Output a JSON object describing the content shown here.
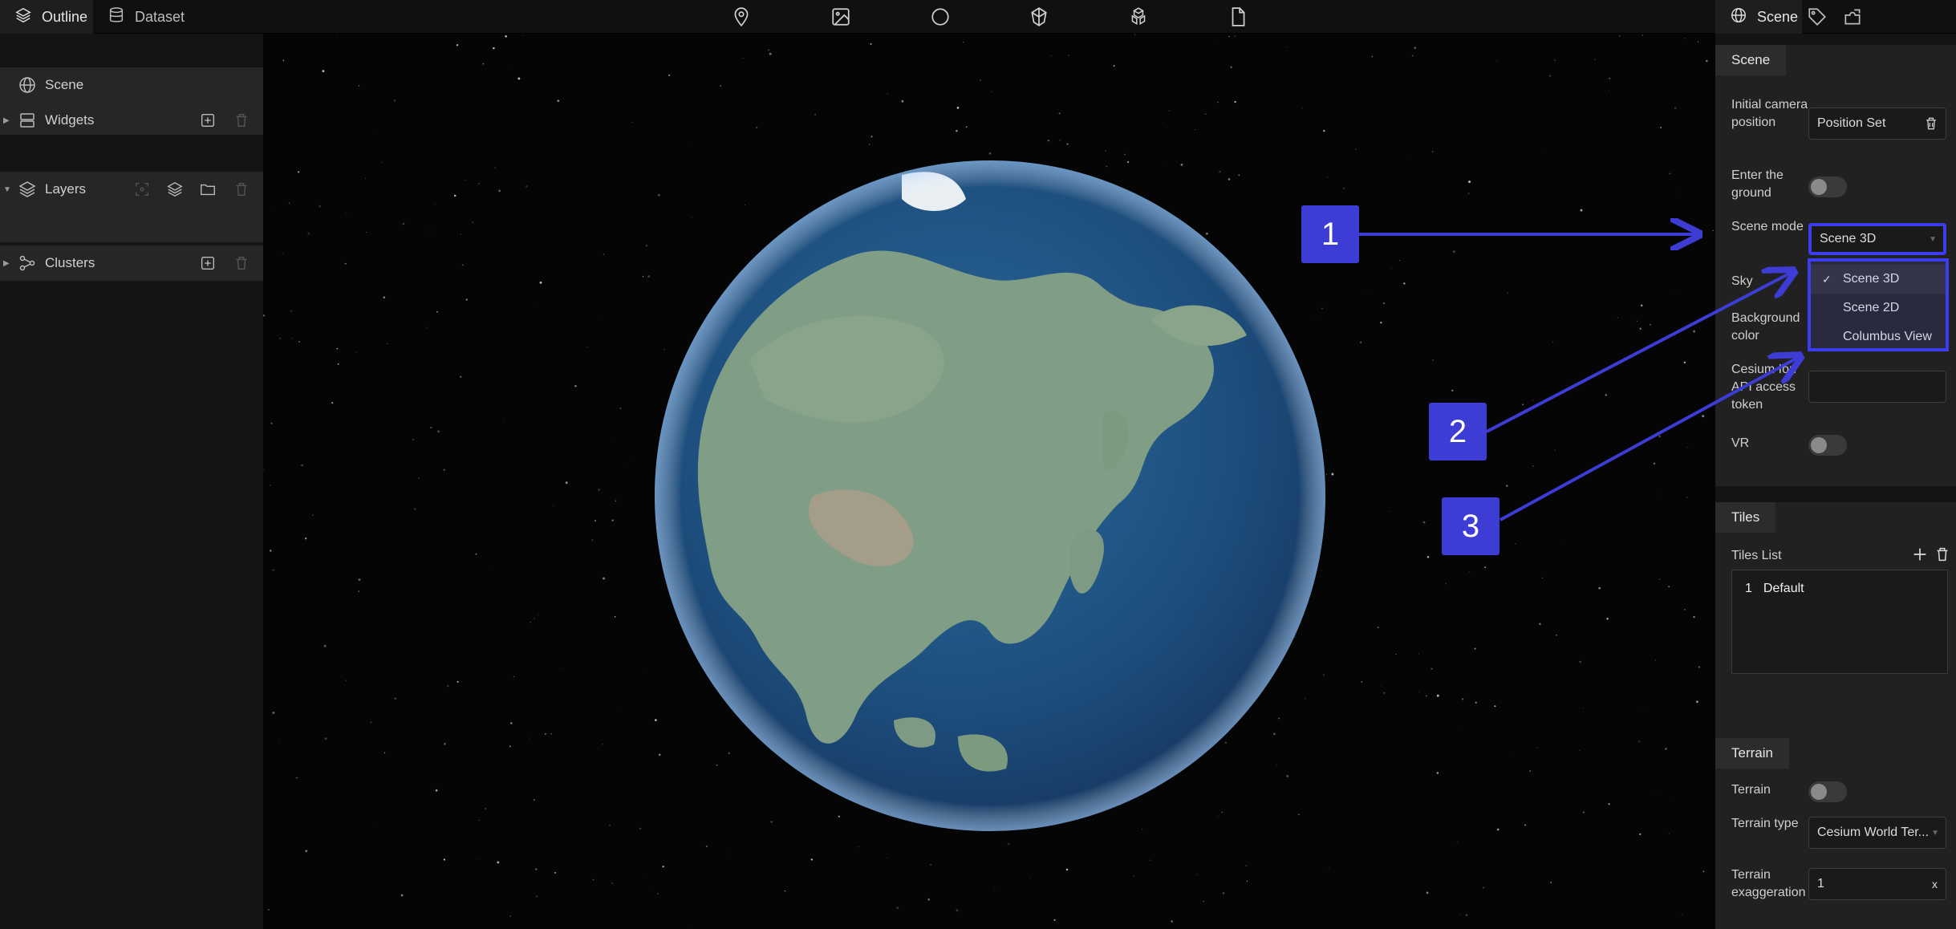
{
  "top_tabs": {
    "outline": "Outline",
    "dataset": "Dataset"
  },
  "toolbar_icons": [
    "map-pin-icon",
    "image-icon",
    "circle-icon",
    "cube-icon",
    "cubes-icon",
    "file-icon"
  ],
  "left_panel": {
    "scene": "Scene",
    "widgets": "Widgets",
    "layers": "Layers",
    "clusters": "Clusters"
  },
  "right_tabs": {
    "scene": "Scene"
  },
  "scene_group": {
    "title": "Scene",
    "initial_camera_label": "Initial camera position",
    "initial_camera_value": "Position Set",
    "enter_ground_label": "Enter the ground",
    "scene_mode_label": "Scene mode",
    "scene_mode_value": "Scene 3D",
    "sky_label": "Sky",
    "background_label": "Background color",
    "token_label": "Cesium Ion API access token",
    "vr_label": "VR"
  },
  "scene_mode_options": [
    "Scene 3D",
    "Scene 2D",
    "Columbus View"
  ],
  "tiles_group": {
    "title": "Tiles",
    "list_label": "Tiles List",
    "item_index": "1",
    "item_name": "Default"
  },
  "terrain_group": {
    "title": "Terrain",
    "terrain_label": "Terrain",
    "type_label": "Terrain type",
    "type_value": "Cesium World Ter...",
    "exag_label": "Terrain exaggeration",
    "exag_value": "1",
    "exag_clear": "x"
  },
  "callouts": [
    "1",
    "2",
    "3"
  ],
  "colors": {
    "accent": "#3d3dd6",
    "ocean": "#1f4f7a",
    "land": "#7f9c82"
  }
}
